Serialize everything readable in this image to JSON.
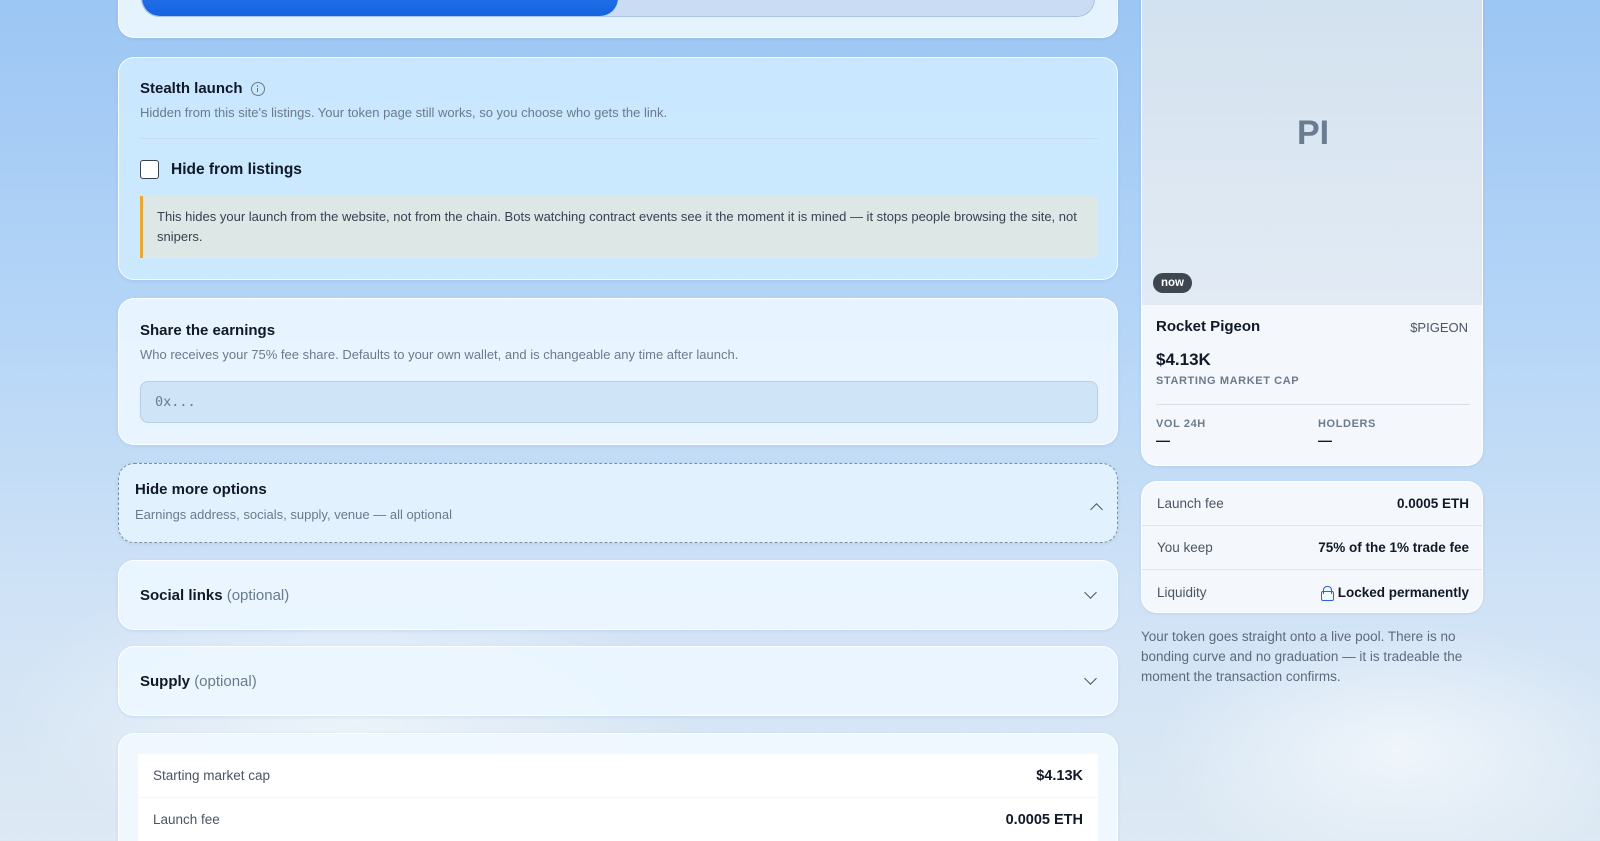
{
  "progress": {
    "fill_fraction": 0.5
  },
  "stealth": {
    "title": "Stealth launch",
    "description": "Hidden from this site's listings. Your token page still works, so you choose who gets the link.",
    "checkbox_label": "Hide from listings",
    "checked": false,
    "warning": "This hides your launch from the website, not from the chain. Bots watching contract events see it the moment it is mined — it stops people browsing the site, not snipers."
  },
  "earnings": {
    "title": "Share the earnings",
    "description": "Who receives your 75% fee share. Defaults to your own wallet, and is changeable any time after launch.",
    "placeholder": "0x...",
    "value": ""
  },
  "more_options": {
    "title": "Hide more options",
    "description": "Earnings address, socials, supply, venue — all optional"
  },
  "social": {
    "title": "Social links",
    "optional": "(optional)"
  },
  "supply": {
    "title": "Supply",
    "optional": "(optional)"
  },
  "summary": {
    "rows": [
      {
        "label": "Starting market cap",
        "value": "$4.13K"
      },
      {
        "label": "Launch fee",
        "value": "0.0005 ETH"
      }
    ]
  },
  "preview": {
    "initials": "PI",
    "badge": "now",
    "name": "Rocket Pigeon",
    "ticker": "$PIGEON",
    "market_cap": "$4.13K",
    "market_cap_label": "STARTING MARKET CAP",
    "stats": [
      {
        "label": "VOL 24H",
        "value": "—"
      },
      {
        "label": "HOLDERS",
        "value": "—"
      }
    ]
  },
  "fees": {
    "rows": [
      {
        "label": "Launch fee",
        "value": "0.0005 ETH"
      },
      {
        "label": "You keep",
        "value": "75% of the 1% trade fee"
      },
      {
        "label": "Liquidity",
        "value": "Locked permanently",
        "icon": "lock-icon"
      }
    ]
  },
  "note": "Your token goes straight onto a live pool. There is no bonding curve and no graduation — it is tradeable the moment the transaction confirms.",
  "colors": {
    "accent": "#1a6ae6",
    "warning_border": "#e8a838"
  }
}
